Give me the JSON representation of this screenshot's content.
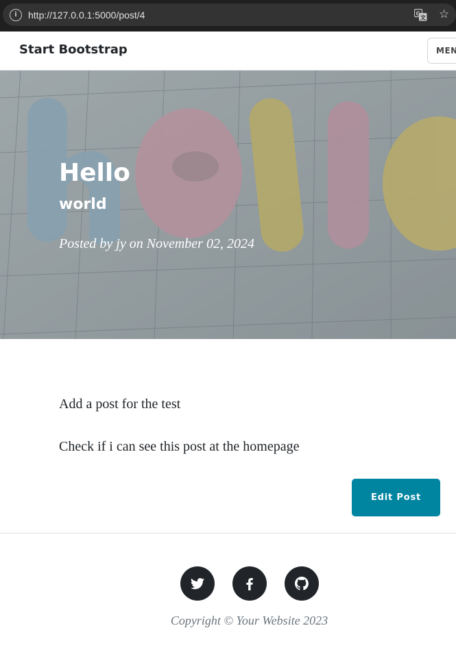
{
  "browser": {
    "url": "http://127.0.0.1:5000/post/4",
    "info_glyph": "i",
    "star_glyph": "☆"
  },
  "navbar": {
    "brand": "Start Bootstrap",
    "menu_label": "MENU"
  },
  "post": {
    "title": "Hello",
    "subtitle": "world",
    "meta": "Posted by jy on November 02, 2024",
    "paragraphs": [
      "Add a post for the test",
      "Check if i can see this post at the homepage"
    ],
    "edit_label": "Edit Post"
  },
  "footer": {
    "social_icons": [
      "twitter-icon",
      "facebook-icon",
      "github-icon"
    ],
    "copyright": "Copyright © Your Website 2023"
  },
  "colors": {
    "browser_bar": "#1f1f1f",
    "accent": "#0085a1",
    "text": "#212529",
    "muted": "#6c757d"
  }
}
